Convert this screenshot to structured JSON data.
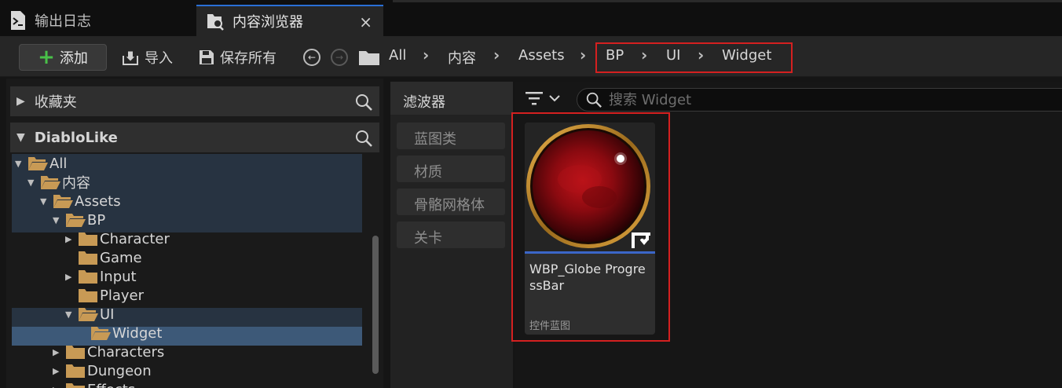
{
  "tabs": {
    "output_log": "输出日志",
    "content_browser": "内容浏览器",
    "close": "×"
  },
  "toolbar": {
    "add": "添加",
    "import": "导入",
    "save_all": "保存所有"
  },
  "breadcrumb": [
    "All",
    "内容",
    "Assets",
    "BP",
    "UI",
    "Widget"
  ],
  "sidebar": {
    "favorites": "收藏夹",
    "project": "DiabloLike",
    "tree": [
      {
        "label": "All",
        "expanded": true
      },
      {
        "label": "内容",
        "expanded": true
      },
      {
        "label": "Assets",
        "expanded": true
      },
      {
        "label": "BP",
        "expanded": true
      },
      {
        "label": "Character",
        "expanded": false
      },
      {
        "label": "Game",
        "expanded": false
      },
      {
        "label": "Input",
        "expanded": false
      },
      {
        "label": "Player",
        "expanded": false
      },
      {
        "label": "UI",
        "expanded": true
      },
      {
        "label": "Widget",
        "selected": true
      },
      {
        "label": "Characters",
        "expanded": false
      },
      {
        "label": "Dungeon",
        "expanded": false
      },
      {
        "label": "Effects",
        "expanded": false
      }
    ]
  },
  "filters": {
    "title": "滤波器",
    "items": [
      "蓝图类",
      "材质",
      "骨骼网格体",
      "关卡"
    ]
  },
  "search": {
    "placeholder": "搜索 Widget"
  },
  "assets": [
    {
      "name": "WBP_Globe ProgressBar",
      "type": "控件蓝图"
    }
  ],
  "colors": {
    "accent": "#2a6fd6",
    "highlight": "#d42020",
    "selection": "#3d5978",
    "add_plus": "#49c049",
    "folder": "#c89a55"
  }
}
